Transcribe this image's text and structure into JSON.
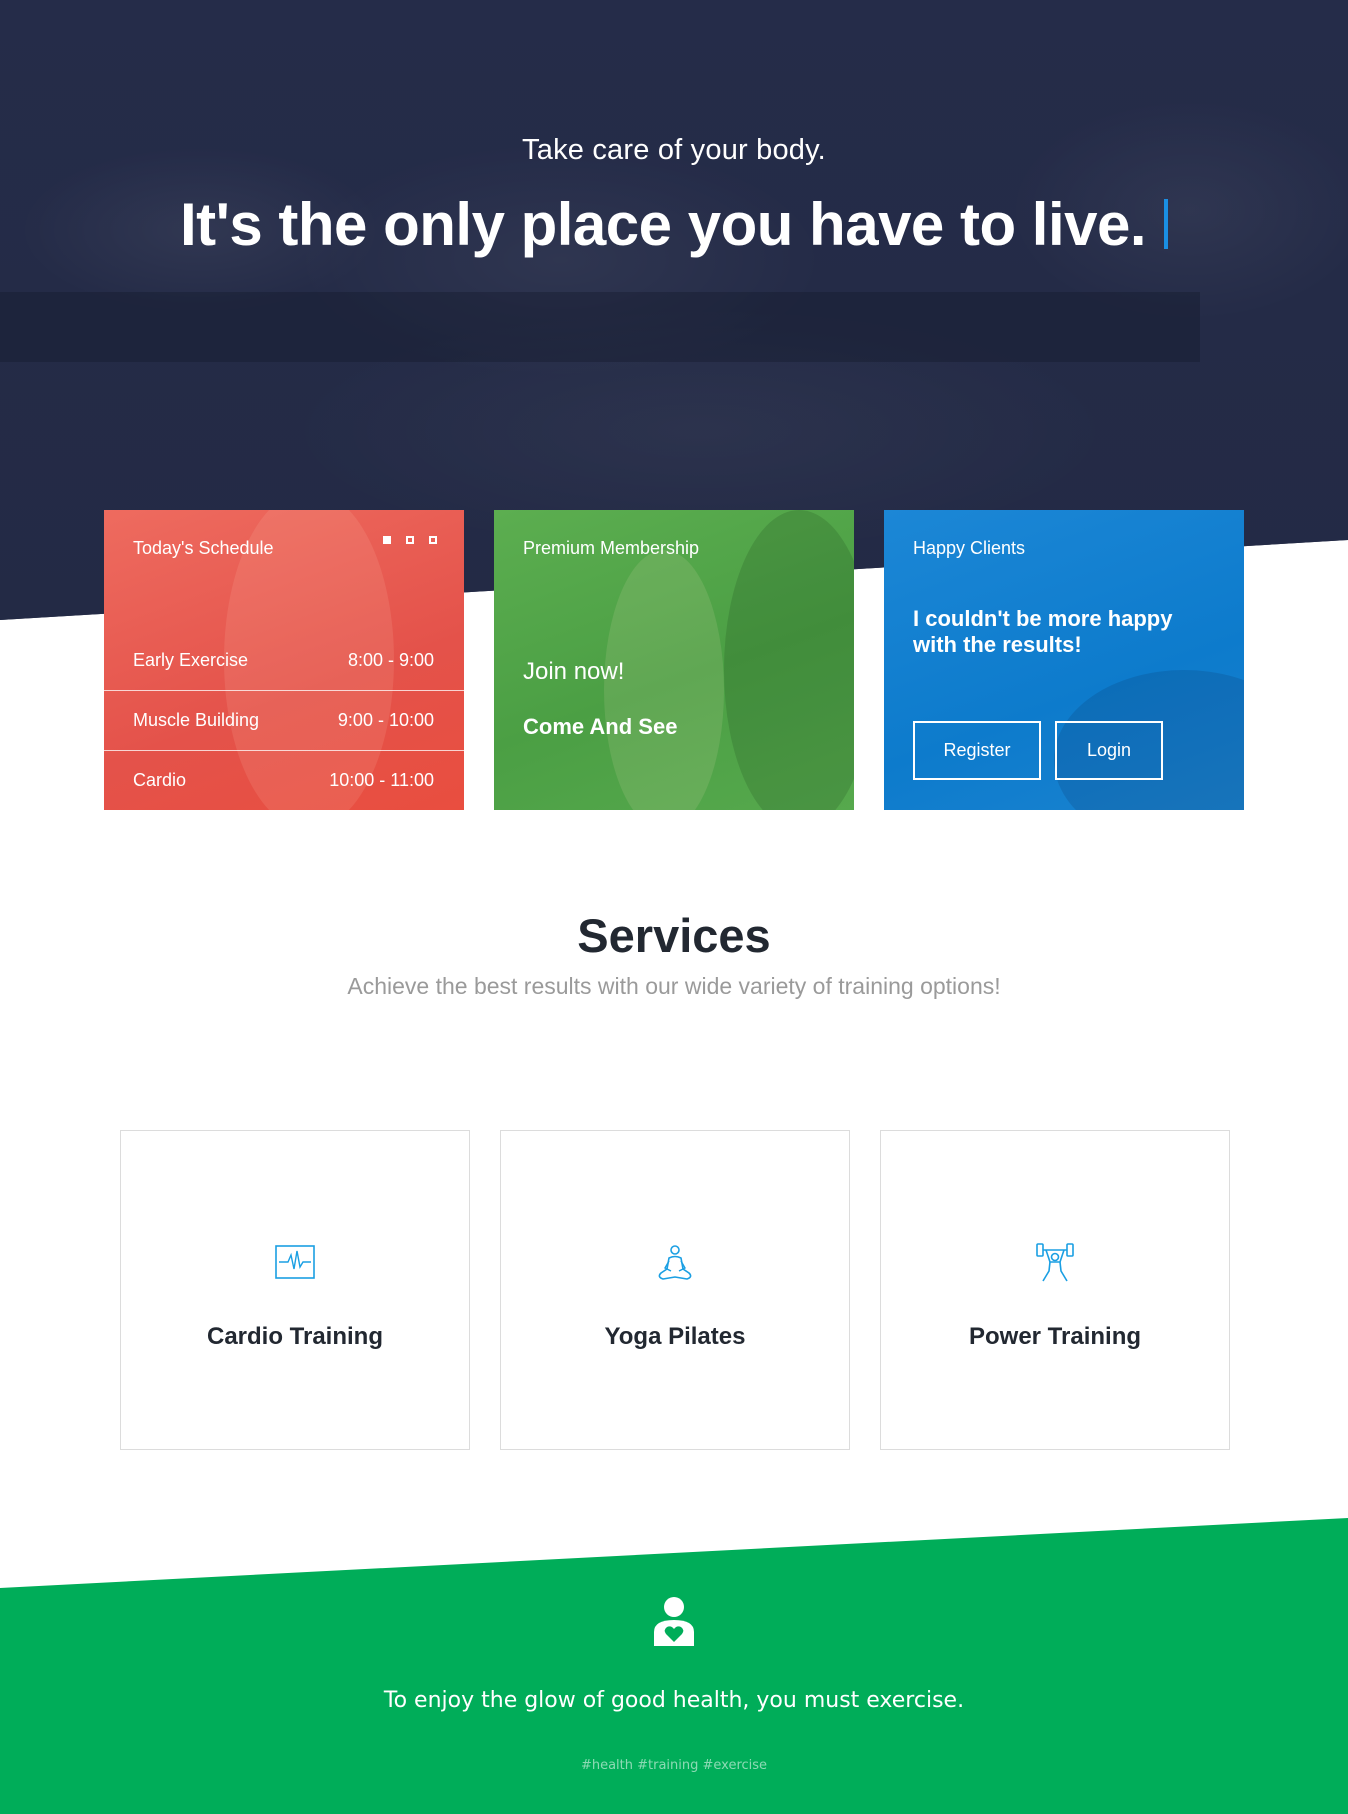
{
  "hero": {
    "subtitle": "Take care of your body.",
    "title": "It's the only place you have to live."
  },
  "schedule": {
    "title": "Today's Schedule",
    "items": [
      {
        "name": "Early Exercise",
        "time": "8:00 - 9:00"
      },
      {
        "name": "Muscle Building",
        "time": "9:00 - 10:00"
      },
      {
        "name": "Cardio",
        "time": "10:00 - 11:00"
      }
    ]
  },
  "membership": {
    "title": "Premium Membership",
    "join": "Join now!",
    "cta": "Come And See"
  },
  "clients": {
    "title": "Happy Clients",
    "quote": "I couldn't be more happy with the results!",
    "register_label": "Register",
    "login_label": "Login"
  },
  "services": {
    "title": "Services",
    "subtitle": "Achieve the best results with our wide variety of training options!",
    "items": [
      {
        "label": "Cardio Training",
        "icon": "heartbeat-monitor-icon"
      },
      {
        "label": "Yoga Pilates",
        "icon": "yoga-meditation-icon"
      },
      {
        "label": "Power Training",
        "icon": "weightlifter-icon"
      }
    ]
  },
  "footer_band": {
    "icon": "person-heart-icon",
    "quote": "To enjoy the glow of good health, you must exercise.",
    "tags": "#health #training #exercise"
  },
  "colors": {
    "hero_bg": "#242b47",
    "schedule_red": "#e4524a",
    "membership_green": "#4b9f44",
    "clients_blue": "#0d7bcc",
    "accent_blue": "#1a8fe3",
    "band_green": "#00ad59"
  }
}
